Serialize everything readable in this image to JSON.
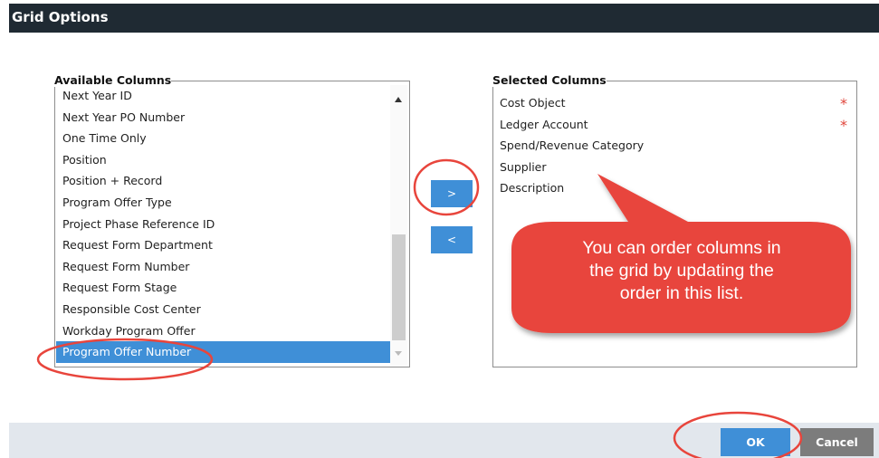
{
  "dialog": {
    "title": "Grid Options"
  },
  "available": {
    "legend": "Available Columns",
    "items": [
      "Next Year ID",
      "Next Year PO Number",
      "One Time Only",
      "Position",
      "Position + Record",
      "Program Offer Type",
      "Project Phase Reference ID",
      "Request Form Department",
      "Request Form Number",
      "Request Form Stage",
      "Responsible Cost Center",
      "Workday Program Offer",
      "Program Offer Number"
    ],
    "selected_item": "Program Offer Number"
  },
  "selected": {
    "legend": "Selected Columns",
    "items": [
      {
        "label": "Cost Object",
        "required": "*"
      },
      {
        "label": "Ledger Account",
        "required": "*"
      },
      {
        "label": "Spend/Revenue Category"
      },
      {
        "label": "Supplier"
      },
      {
        "label": "Description"
      }
    ]
  },
  "move": {
    "add_label": ">",
    "remove_label": "<"
  },
  "footer": {
    "ok_label": "OK",
    "cancel_label": "Cancel"
  },
  "callout": {
    "lines": [
      "You can order columns in",
      "the grid by updating the",
      "order in this list."
    ],
    "color": "#e8453c"
  },
  "colors": {
    "accent": "#3f8fd7",
    "titlebar": "#1f2a33",
    "annotation": "#e8453c"
  }
}
